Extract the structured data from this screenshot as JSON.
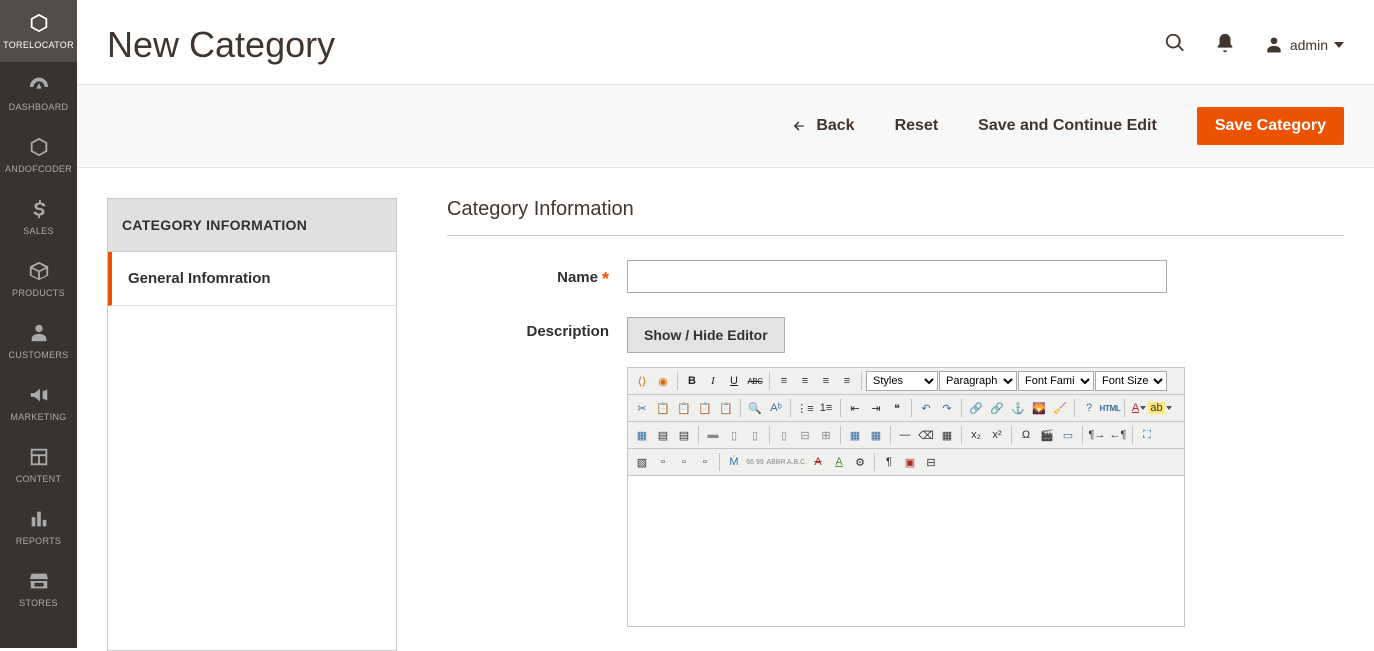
{
  "sidebar": {
    "items": [
      {
        "label": "TORELOCATOR"
      },
      {
        "label": "DASHBOARD"
      },
      {
        "label": "ANDOFCODER"
      },
      {
        "label": "SALES"
      },
      {
        "label": "PRODUCTS"
      },
      {
        "label": "CUSTOMERS"
      },
      {
        "label": "MARKETING"
      },
      {
        "label": "CONTENT"
      },
      {
        "label": "REPORTS"
      },
      {
        "label": "STORES"
      }
    ]
  },
  "header": {
    "title": "New Category",
    "user": "admin"
  },
  "actions": {
    "back": "Back",
    "reset": "Reset",
    "save_continue": "Save and Continue Edit",
    "save": "Save Category"
  },
  "panel": {
    "header": "CATEGORY INFORMATION",
    "tab": "General Infomration"
  },
  "form": {
    "section_title": "Category Information",
    "name_label": "Name",
    "name_value": "",
    "desc_label": "Description",
    "toggle_editor": "Show / Hide Editor"
  },
  "editor": {
    "styles": "Styles",
    "paragraph": "Paragraph",
    "font_family": "Font Family",
    "font_size": "Font Size"
  }
}
